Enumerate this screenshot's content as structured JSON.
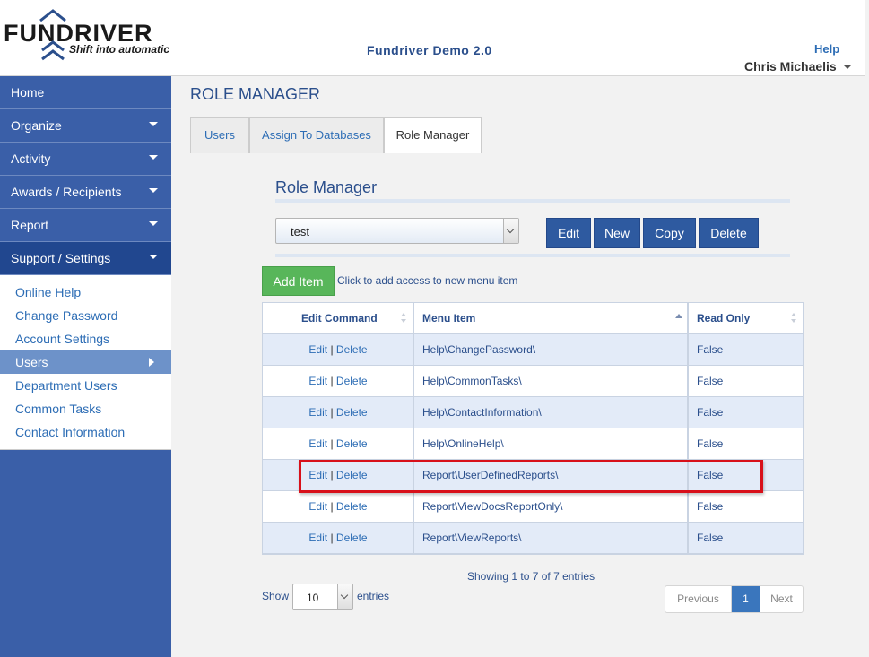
{
  "header": {
    "logo_text": "FUNDRIVER",
    "logo_tagline": "Shift into automatic",
    "app_title": "Fundriver Demo 2.0",
    "help_label": "Help",
    "user_name": "Chris Michaelis"
  },
  "sidebar": {
    "items": [
      {
        "label": "Home",
        "has_caret": false
      },
      {
        "label": "Organize",
        "has_caret": true
      },
      {
        "label": "Activity",
        "has_caret": true
      },
      {
        "label": "Awards / Recipients",
        "has_caret": true
      },
      {
        "label": "Report",
        "has_caret": true
      },
      {
        "label": "Support / Settings",
        "has_caret": true
      }
    ],
    "subitems": [
      "Online Help",
      "Change Password",
      "Account Settings",
      "Users",
      "Department Users",
      "Common Tasks",
      "Contact Information"
    ],
    "active_subitem": "Users"
  },
  "main": {
    "page_title": "ROLE MANAGER",
    "tabs": [
      "Users",
      "Assign To Databases",
      "Role Manager"
    ],
    "active_tab": "Role Manager",
    "section_title": "Role Manager",
    "role_select_value": "test",
    "buttons": {
      "edit": "Edit",
      "new": "New",
      "copy": "Copy",
      "delete": "Delete"
    },
    "add_item_label": "Add Item",
    "add_item_hint": "Click to add access to new menu item"
  },
  "table": {
    "columns": [
      "Edit Command",
      "Menu Item",
      "Read Only"
    ],
    "edit_label": "Edit",
    "delete_label": "Delete",
    "separator": "|",
    "rows": [
      {
        "menu_item": "Help\\ChangePassword\\",
        "read_only": "False"
      },
      {
        "menu_item": "Help\\CommonTasks\\",
        "read_only": "False"
      },
      {
        "menu_item": "Help\\ContactInformation\\",
        "read_only": "False"
      },
      {
        "menu_item": "Help\\OnlineHelp\\",
        "read_only": "False"
      },
      {
        "menu_item": "Report\\UserDefinedReports\\",
        "read_only": "False"
      },
      {
        "menu_item": "Report\\ViewDocsReportOnly\\",
        "read_only": "False"
      },
      {
        "menu_item": "Report\\ViewReports\\",
        "read_only": "False"
      }
    ],
    "highlighted_row_index": 4,
    "info_text": "Showing 1 to 7 of 7 entries",
    "show_label": "Show",
    "page_length": "10",
    "entries_label": "entries",
    "pager": {
      "previous": "Previous",
      "current_page": "1",
      "next": "Next"
    }
  },
  "colors": {
    "sidebar_bg": "#3a5fa8",
    "sidebar_active": "#21478f",
    "button_blue": "#2e5aa0",
    "add_green": "#58b65a",
    "highlight_red": "#d8101a",
    "link_blue": "#2d6db5"
  }
}
